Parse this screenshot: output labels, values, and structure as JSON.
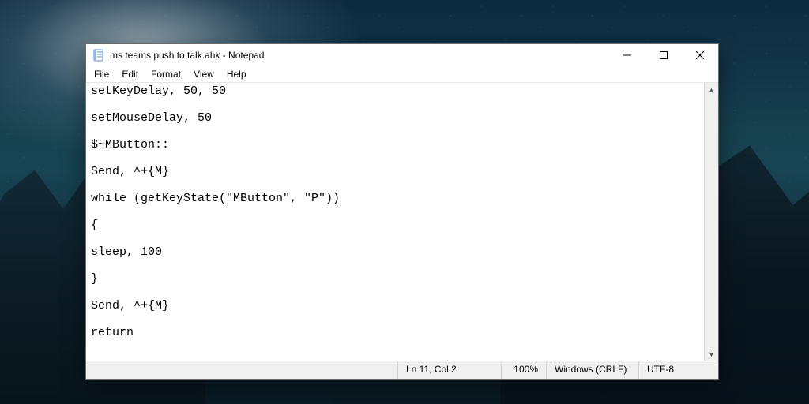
{
  "window": {
    "title": "ms teams push to talk.ahk - Notepad"
  },
  "menu": {
    "file": "File",
    "edit": "Edit",
    "format": "Format",
    "view": "View",
    "help": "Help"
  },
  "editor": {
    "content": "setKeyDelay, 50, 50\n\nsetMouseDelay, 50\n\n$~MButton::\n\nSend, ^+{M}\n\nwhile (getKeyState(\"MButton\", \"P\"))\n\n{\n\nsleep, 100\n\n}\n\nSend, ^+{M}\n\nreturn"
  },
  "status": {
    "lncol": "Ln 11, Col 2",
    "zoom": "100%",
    "eol": "Windows (CRLF)",
    "encoding": "UTF-8"
  }
}
